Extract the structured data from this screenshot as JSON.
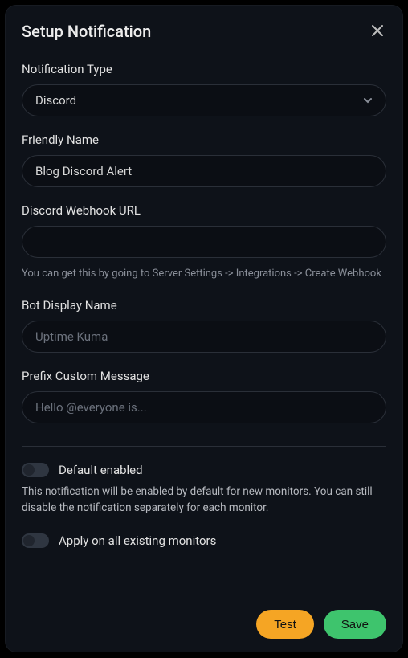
{
  "modal": {
    "title": "Setup Notification"
  },
  "fields": {
    "type": {
      "label": "Notification Type",
      "value": "Discord"
    },
    "friendlyName": {
      "label": "Friendly Name",
      "value": "Blog Discord Alert"
    },
    "webhook": {
      "label": "Discord Webhook URL",
      "value": "",
      "help": "You can get this by going to Server Settings -> Integrations -> Create Webhook"
    },
    "botName": {
      "label": "Bot Display Name",
      "placeholder": "Uptime Kuma",
      "value": ""
    },
    "prefix": {
      "label": "Prefix Custom Message",
      "placeholder": "Hello @everyone is...",
      "value": ""
    }
  },
  "toggles": {
    "defaultEnabled": {
      "label": "Default enabled",
      "help": "This notification will be enabled by default for new monitors. You can still disable the notification separately for each monitor."
    },
    "applyAll": {
      "label": "Apply on all existing monitors"
    }
  },
  "footer": {
    "test": "Test",
    "save": "Save"
  }
}
